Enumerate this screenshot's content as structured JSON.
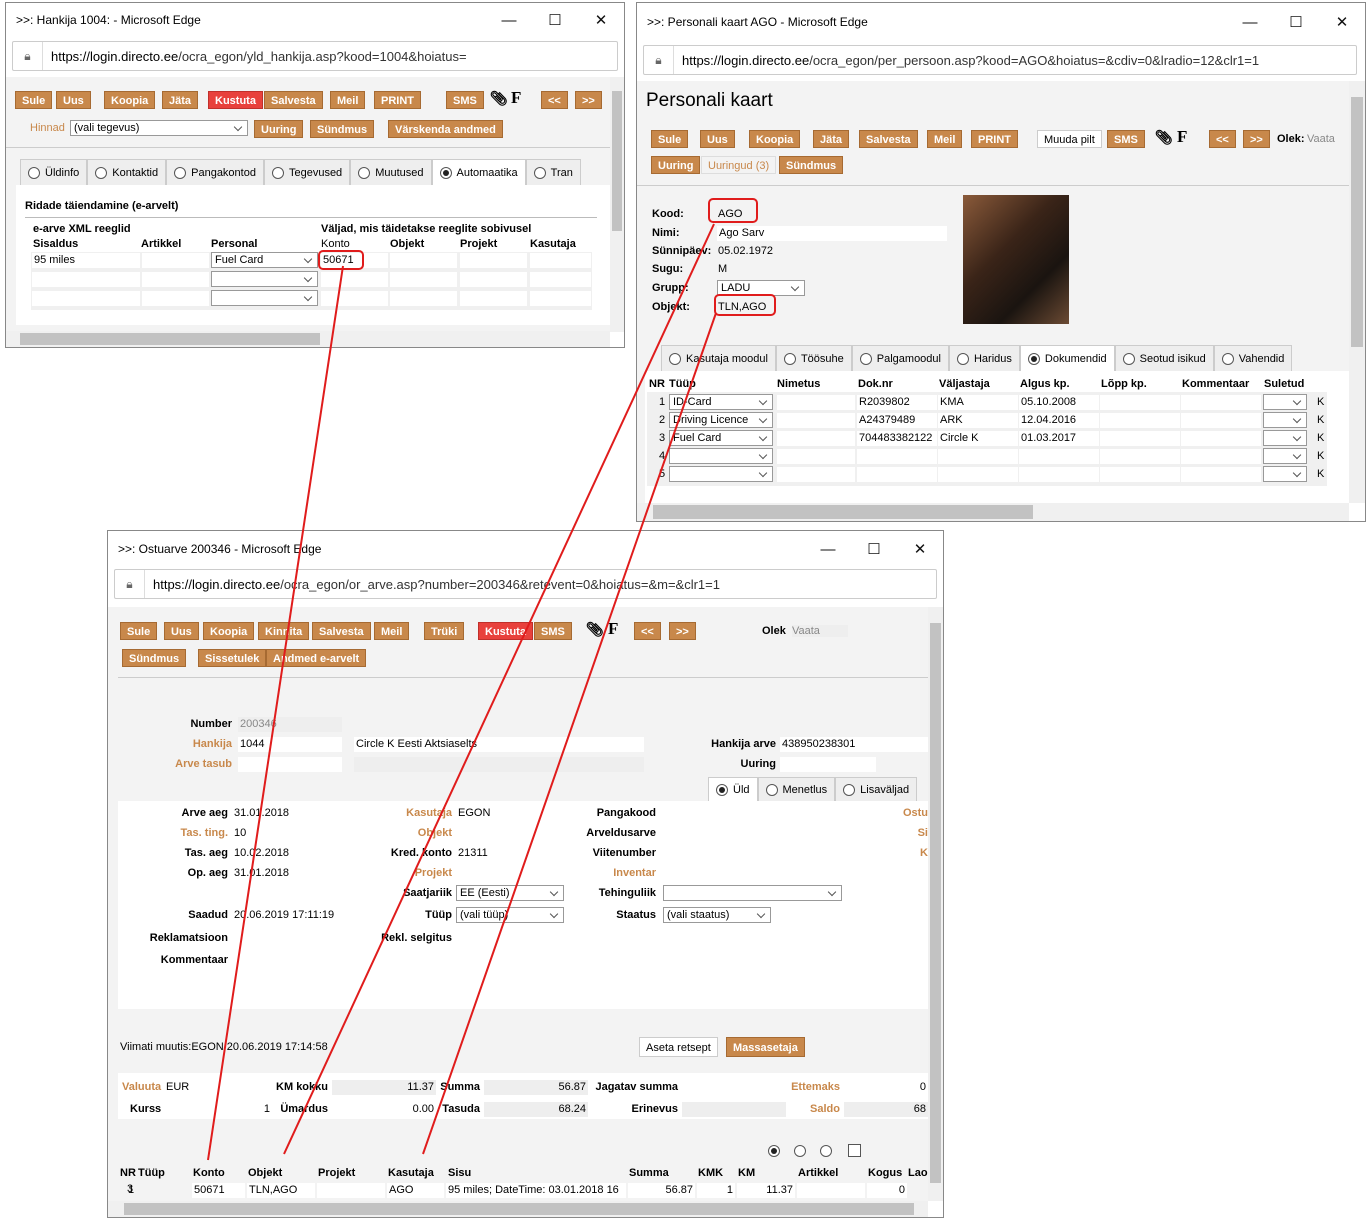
{
  "win1": {
    "title": ">>: Hankija 1004: - Microsoft Edge",
    "url_domain": "https://login.directo.ee",
    "url_path": "/ocra_egon/yld_hankija.asp?kood=1004&hoiatus=",
    "buttons": [
      "Sule",
      "Uus",
      "Koopia",
      "Jäta",
      "Kustuta",
      "Salvesta",
      "Meil",
      "PRINT",
      "SMS",
      "<<",
      ">>"
    ],
    "hinnad_label": "Hinnad",
    "hinnad_value": "(vali tegevus)",
    "buttons2": [
      "Uuring",
      "Sündmus",
      "Värskenda andmed"
    ],
    "tabs": [
      "Üldinfo",
      "Kontaktid",
      "Pangakontod",
      "Tegevused",
      "Muutused",
      "Automaatika",
      "Tran"
    ],
    "section_title": "Ridade täiendamine (e-arvelt)",
    "group1": "e-arve XML reeglid",
    "group2": "Väljad, mis täidetakse reeglite sobivusel",
    "cols": [
      "Sisaldus",
      "Artikkel",
      "Personal",
      "Konto",
      "Objekt",
      "Projekt",
      "Kasutaja"
    ],
    "row1": {
      "sisaldus": "95 miles",
      "personal": "Fuel Card",
      "konto": "50671"
    }
  },
  "win2": {
    "title": ">>: Personali kaart AGO - Microsoft Edge",
    "url_domain": "https://login.directo.ee",
    "url_path": "/ocra_egon/per_persoon.asp?kood=AGO&hoiatus=&cdiv=0&lradio=12&clr1=1",
    "heading": "Personali kaart",
    "buttons": [
      "Sule",
      "Uus",
      "Koopia",
      "Jäta",
      "Salvesta",
      "Meil",
      "PRINT",
      "Muuda pilt",
      "SMS",
      "<<",
      ">>"
    ],
    "olek_label": "Olek:",
    "olek_value": "Vaata",
    "buttons2": [
      "Uuring",
      "Uuringud (3)",
      "Sündmus"
    ],
    "fields": {
      "kood_label": "Kood:",
      "kood": "AGO",
      "nimi_label": "Nimi:",
      "nimi": "Ago Sarv",
      "synni_label": "Sünnipäev:",
      "synni": "05.02.1972",
      "sugu_label": "Sugu:",
      "sugu": "M",
      "grupp_label": "Grupp:",
      "grupp": "LADU",
      "objekt_label": "Objekt:",
      "objekt": "TLN,AGO"
    },
    "tabs": [
      "Kasutaja moodul",
      "Töösuhe",
      "Palgamoodul",
      "Haridus",
      "Dokumendid",
      "Seotud isikud",
      "Vahendid"
    ],
    "cols": [
      "NR",
      "Tüüp",
      "Nimetus",
      "Dok.nr",
      "Väljastaja",
      "Algus kp.",
      "Lõpp kp.",
      "Kommentaar",
      "Suletud"
    ],
    "rows": [
      {
        "nr": "1",
        "tyyp": "ID-Card",
        "dok": "R2039802",
        "valj": "KMA",
        "algus": "05.10.2008",
        "k": "K"
      },
      {
        "nr": "2",
        "tyyp": "Driving Licence",
        "dok": "A24379489",
        "valj": "ARK",
        "algus": "12.04.2016",
        "k": "K"
      },
      {
        "nr": "3",
        "tyyp": "Fuel Card",
        "dok": "704483382122",
        "valj": "Circle K",
        "algus": "01.03.2017",
        "k": "K"
      },
      {
        "nr": "4",
        "tyyp": "",
        "dok": "",
        "valj": "",
        "algus": "",
        "k": "K"
      },
      {
        "nr": "5",
        "tyyp": "",
        "dok": "",
        "valj": "",
        "algus": "",
        "k": "K"
      }
    ]
  },
  "win3": {
    "title": ">>: Ostuarve 200346 - Microsoft Edge",
    "url_domain": "https://login.directo.ee",
    "url_path": "/ocra_egon/or_arve.asp?number=200346&retevent=0&hoiatus=&m=&clr1=1",
    "buttons": [
      "Sule",
      "Uus",
      "Koopia",
      "Kinnita",
      "Salvesta",
      "Meil",
      "Trüki",
      "Kustuta",
      "SMS",
      "<<",
      ">>"
    ],
    "olek_label": "Olek",
    "olek_value": "Vaata",
    "buttons2": [
      "Sündmus",
      "Sissetulek",
      "Andmed e-arvelt"
    ],
    "head": {
      "number_label": "Number",
      "number": "200346",
      "hankija_label": "Hankija",
      "hankija": "1044",
      "hankija_name": "Circle K Eesti Aktsiaselts",
      "arve_tasub_label": "Arve tasub",
      "hankija_arve_label": "Hankija arve",
      "hankija_arve": "438950238301",
      "uuring_label": "Uuring"
    },
    "tabs": [
      "Üld",
      "Menetlus",
      "Lisaväljad"
    ],
    "fields": {
      "arve_aeg_label": "Arve aeg",
      "arve_aeg": "31.01.2018",
      "tas_ting_label": "Tas. ting.",
      "tas_ting": "10",
      "tas_aeg_label": "Tas. aeg",
      "tas_aeg": "10.02.2018",
      "op_aeg_label": "Op. aeg",
      "op_aeg": "31.01.2018",
      "saadud_label": "Saadud",
      "saadud": "20.06.2019 17:11:19",
      "reklam_label": "Reklamatsioon",
      "kommentaar_label": "Kommentaar",
      "kasutaja_label": "Kasutaja",
      "kasutaja": "EGON",
      "objekt_label": "Objekt",
      "kred_label": "Kred. konto",
      "kred": "21311",
      "projekt_label": "Projekt",
      "saatjariik_label": "Saatjariik",
      "saatjariik": "EE (Eesti)",
      "tyyp_label": "Tüüp",
      "tyyp": "(vali tüüp)",
      "rekl_label": "Rekl. selgitus",
      "pangakood_label": "Pangakood",
      "arveldus_label": "Arveldusarve",
      "viite_label": "Viitenumber",
      "inventar_label": "Inventar",
      "tehingu_label": "Tehinguliik",
      "staatus_label": "Staatus",
      "staatus": "(vali staatus)",
      "ostu": "Ostu",
      "si": "Si",
      "k": "K"
    },
    "viimati": "Viimati muutis:EGON 20.06.2019 17:14:58",
    "aseta": "Aseta retsept",
    "massasetaja": "Massasetaja",
    "totals": {
      "valuuta_label": "Valuuta",
      "valuuta": "EUR",
      "km_label": "KM kokku",
      "km": "11.37",
      "summa_label": "Summa",
      "summa": "56.87",
      "jagatav_label": "Jagatav summa",
      "ettemaks_label": "Ettemaks",
      "ettemaks": "0",
      "kurss_label": "Kurss",
      "kurss": "1",
      "umardus_label": "Ümardus",
      "umardus": "0.00",
      "tasuda_label": "Tasuda",
      "tasuda": "68.24",
      "erinevus_label": "Erinevus",
      "saldo_label": "Saldo",
      "saldo": "68"
    },
    "cols": [
      "NR",
      "Tüüp",
      "Konto",
      "Objekt",
      "Projekt",
      "Kasutaja",
      "Sisu",
      "Summa",
      "KMK",
      "KM",
      "Artikkel",
      "Kogus",
      "Lao"
    ],
    "row1": {
      "nr": "1",
      "konto": "50671",
      "objekt": "TLN,AGO",
      "kasutaja": "AGO",
      "sisu": "95 miles; DateTime: 03.01.2018 16",
      "summa": "56.87",
      "kmk": "1",
      "km": "11.37",
      "kogus": "0"
    },
    "row2": "2",
    "row3": "3"
  },
  "colors": {
    "accent": "#c8884b",
    "danger": "#e8413c",
    "highlight": "#e01c1c"
  }
}
